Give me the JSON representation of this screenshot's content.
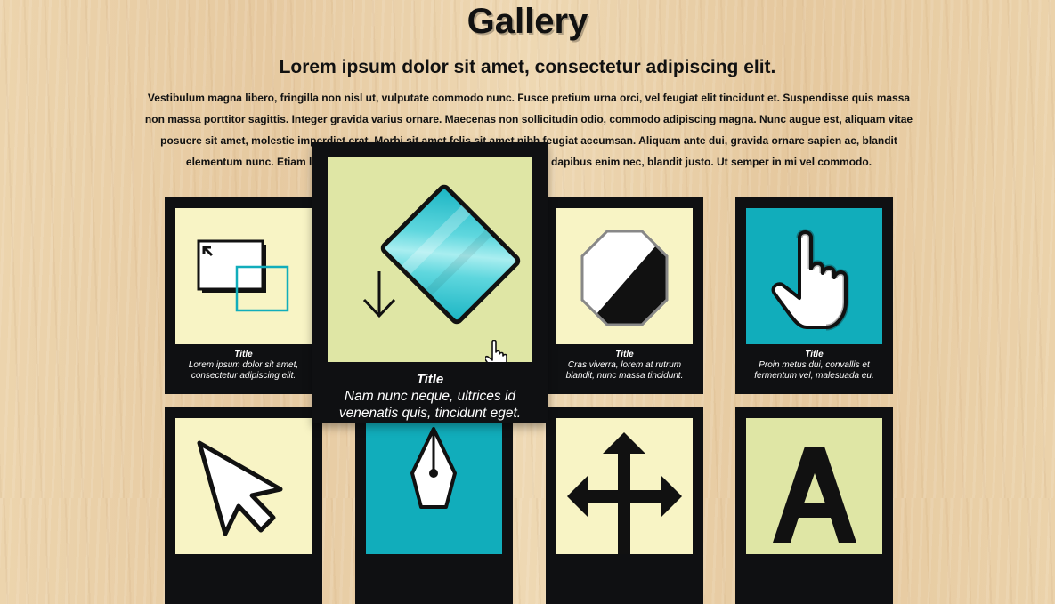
{
  "page": {
    "title": "Gallery",
    "subtitle": "Lorem ipsum dolor sit amet, consectetur adipiscing elit.",
    "intro": "Vestibulum magna libero, fringilla non nisl ut, vulputate commodo nunc. Fusce pretium urna orci, vel feugiat elit tincidunt et. Suspendisse quis massa non massa porttitor sagittis. Integer gravida varius ornare. Maecenas non sollicitudin odio, commodo adipiscing magna. Nunc augue est, aliquam vitae posuere sit amet, molestie imperdiet erat. Morbi sit amet felis sit amet nibh feugiat accumsan. Aliquam ante dui, gravida ornare sapien ac, blandit elementum nunc. Etiam lobortis dapibus arcu. Nunc et lectus interdum, dapibus enim nec, blandit justo. Ut semper in mi vel commodo."
  },
  "colors": {
    "card_frame": "#0f1012",
    "thumb_pale": "#f8f4c5",
    "thumb_sage": "#dfe6a5",
    "thumb_teal": "#11adbb",
    "background_wood": "#e9cfa6"
  },
  "gallery": {
    "cards": [
      {
        "icon": "window-resize-icon",
        "title": "Title",
        "text": "Lorem ipsum dolor sit amet, consectetur adipiscing elit."
      },
      {
        "icon": "gradient-tilt-icon",
        "title": "Title",
        "text": "Nam nunc neque, ultrices id venenatis quis, tincidunt eget.",
        "hovered": true
      },
      {
        "icon": "octagon-contrast-icon",
        "title": "Title",
        "text": "Cras viverra, lorem at rutrum blandit, nunc massa tincidunt."
      },
      {
        "icon": "hand-pointer-icon",
        "title": "Title",
        "text": "Proin metus dui, convallis et fermentum vel, malesuada eu."
      },
      {
        "icon": "arrow-cursor-icon"
      },
      {
        "icon": "pen-nib-icon"
      },
      {
        "icon": "move-arrows-icon"
      },
      {
        "icon": "text-a-icon"
      }
    ]
  },
  "cursor": {
    "icon": "hand-cursor-icon"
  }
}
